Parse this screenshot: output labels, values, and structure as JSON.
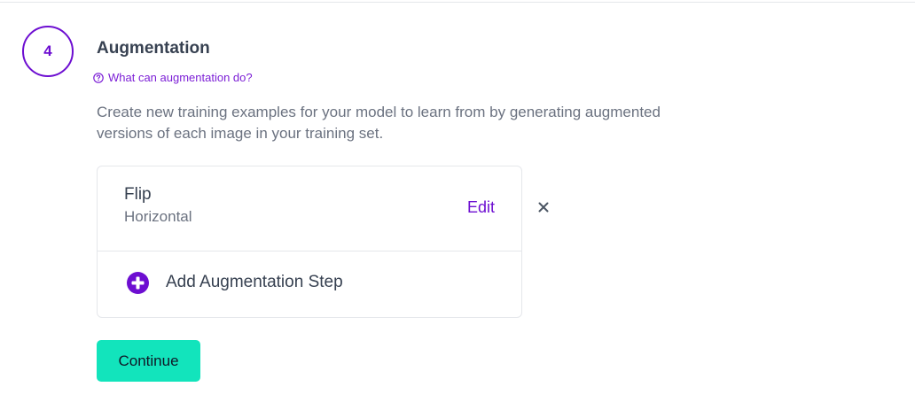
{
  "step": {
    "number": "4",
    "title": "Augmentation",
    "help_link": "What can augmentation do?",
    "description": "Create new training examples for your model to learn from by generating augmented versions of each image in your training set."
  },
  "augmentations": [
    {
      "name": "Flip",
      "detail": "Horizontal",
      "edit_label": "Edit"
    }
  ],
  "add_step_label": "Add Augmentation Step",
  "continue_label": "Continue",
  "icons": {
    "help": "question-circle-icon",
    "add": "plus-circle-icon",
    "remove": "close-icon"
  },
  "colors": {
    "accent": "#6d0ed1",
    "continue_button": "#12e4bc"
  }
}
